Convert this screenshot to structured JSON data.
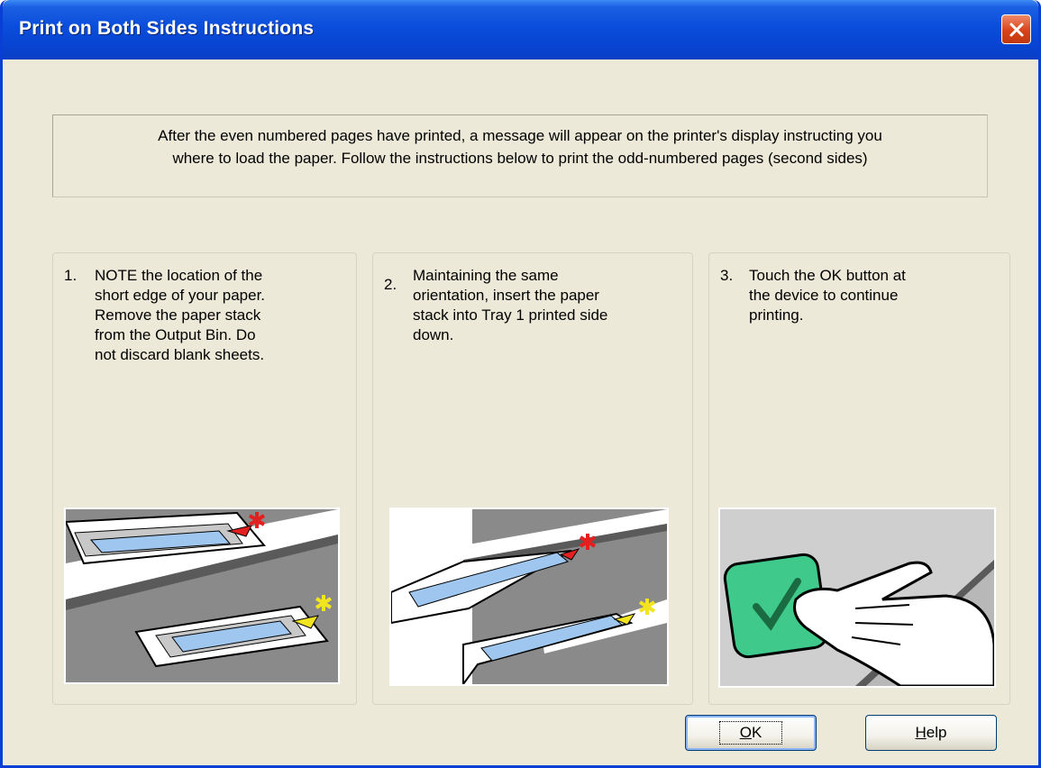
{
  "window": {
    "title": "Print on Both Sides Instructions"
  },
  "message": {
    "line1": "After the even numbered pages have printed, a message will appear on the printer's display instructing you",
    "line2": "where to load the paper. Follow the instructions below to print the odd-numbered pages (second sides)"
  },
  "steps": [
    {
      "number": "1.",
      "lines": [
        "NOTE the location of the",
        "short edge of your paper.",
        "Remove the  paper stack",
        "from the Output Bin.  Do",
        "not discard blank sheets."
      ]
    },
    {
      "number": "2.",
      "lines": [
        "Maintaining the same",
        "orientation, insert the paper",
        "stack into Tray 1 printed side",
        "down."
      ]
    },
    {
      "number": "3.",
      "lines": [
        "Touch the OK button at",
        "the device to continue",
        "printing."
      ]
    }
  ],
  "buttons": {
    "ok": {
      "mnemonic": "O",
      "rest": "K"
    },
    "help": {
      "mnemonic": "H",
      "rest": "elp"
    }
  },
  "icons": {
    "close": "close-icon",
    "marker_red": "asterisk-red-icon",
    "marker_yellow": "asterisk-yellow-icon",
    "check": "checkmark-icon"
  },
  "colors": {
    "title_bar": "#0a4ddc",
    "close_button": "#d9421b",
    "panel_bg": "#ece9d8",
    "ok_button_touch": "#3fc98a"
  }
}
